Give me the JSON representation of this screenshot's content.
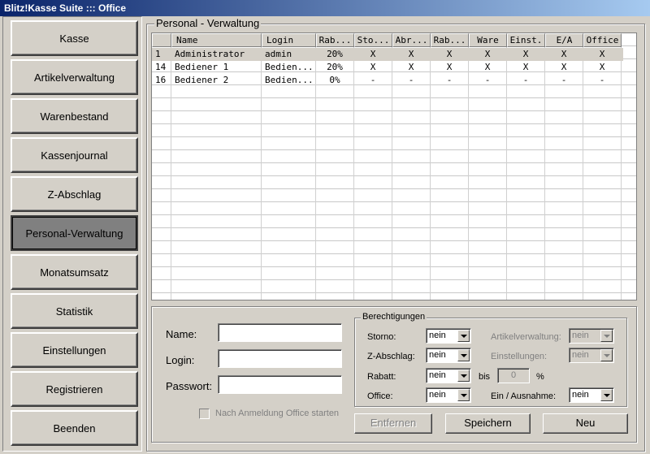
{
  "window": {
    "title": "Blitz!Kasse Suite ::: Office"
  },
  "nav": [
    {
      "label": "Kasse"
    },
    {
      "label": "Artikelverwaltung"
    },
    {
      "label": "Warenbestand"
    },
    {
      "label": "Kassenjournal"
    },
    {
      "label": "Z-Abschlag"
    },
    {
      "label": "Personal-Verwaltung",
      "active": true
    },
    {
      "label": "Monatsumsatz"
    },
    {
      "label": "Statistik"
    },
    {
      "label": "Einstellungen"
    },
    {
      "label": "Registrieren"
    },
    {
      "label": "Beenden"
    }
  ],
  "main": {
    "group_title": "Personal - Verwaltung",
    "columns": [
      "",
      "Name",
      "Login",
      "Rab...",
      "Sto...",
      "Abr...",
      "Rab...",
      "Ware",
      "Einst.",
      "E/A",
      "Office"
    ],
    "rows": [
      [
        "1",
        "Administrator",
        "admin",
        "20%",
        "X",
        "X",
        "X",
        "X",
        "X",
        "X",
        "X"
      ],
      [
        "14",
        "Bediener 1",
        "Bedien...",
        "20%",
        "X",
        "X",
        "X",
        "X",
        "X",
        "X",
        "X"
      ],
      [
        "16",
        "Bediener 2",
        "Bedien...",
        "0%",
        "-",
        "-",
        "-",
        "-",
        "-",
        "-",
        "-"
      ]
    ],
    "selected_row": 0
  },
  "form": {
    "name_label": "Name:",
    "login_label": "Login:",
    "password_label": "Passwort:",
    "name_value": "",
    "login_value": "",
    "password_value": "",
    "autostart_label": "Nach Anmeldung Office starten",
    "permissions_title": "Berechtigungen",
    "storno_label": "Storno:",
    "storno_value": "nein",
    "zabschlag_label": "Z-Abschlag:",
    "zabschlag_value": "nein",
    "rabatt_label": "Rabatt:",
    "rabatt_value": "nein",
    "bis_label": "bis",
    "bis_value": "0",
    "percent_label": "%",
    "office_label": "Office:",
    "office_value": "nein",
    "artikel_label": "Artikelverwaltung:",
    "artikel_value": "nein",
    "einstellungen_label": "Einstellungen:",
    "einstellungen_value": "nein",
    "einaus_label": "Ein / Ausnahme:",
    "einaus_value": "nein"
  },
  "actions": {
    "remove_label": "Entfernen",
    "save_label": "Speichern",
    "new_label": "Neu"
  }
}
